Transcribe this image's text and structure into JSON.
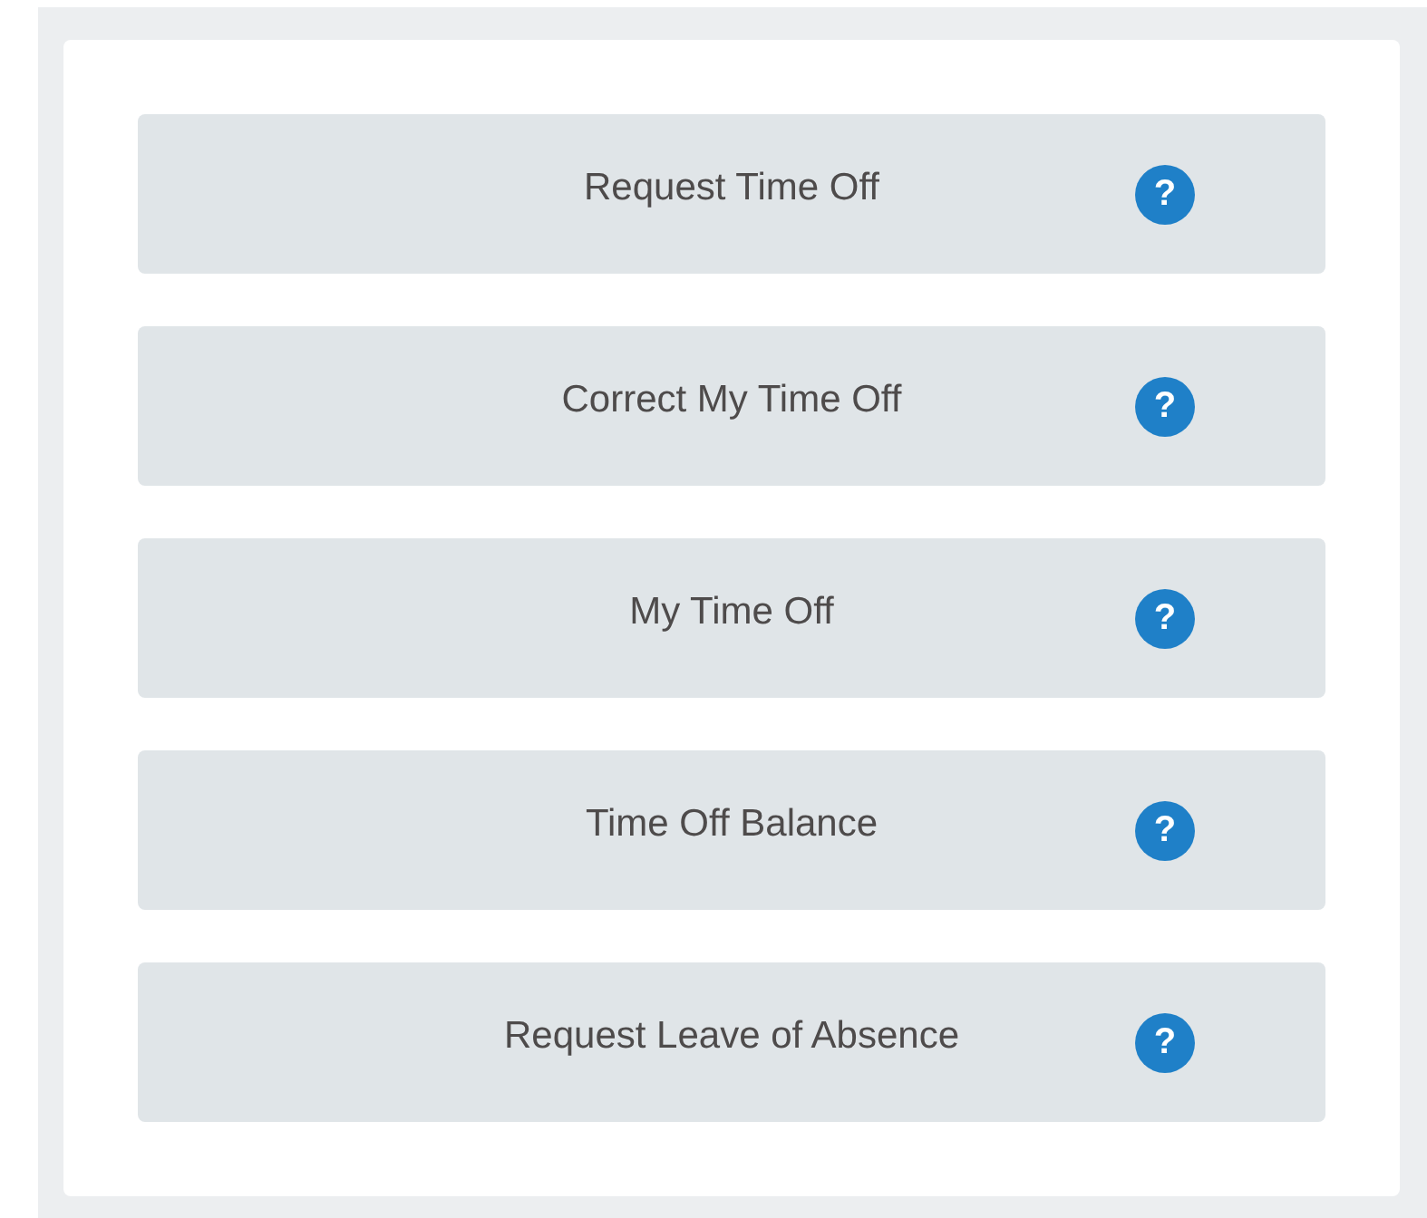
{
  "actions": [
    {
      "label": "Request Time Off",
      "help": "?"
    },
    {
      "label": "Correct My Time Off",
      "help": "?"
    },
    {
      "label": "My Time Off",
      "help": "?"
    },
    {
      "label": "Time Off Balance",
      "help": "?"
    },
    {
      "label": "Request Leave of Absence",
      "help": "?"
    }
  ]
}
